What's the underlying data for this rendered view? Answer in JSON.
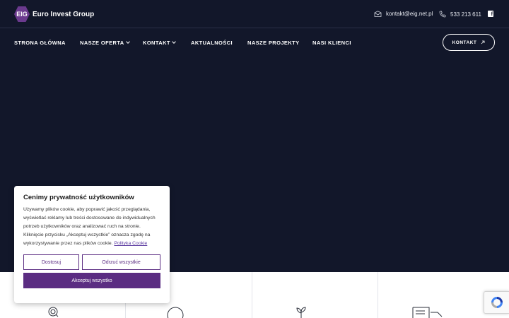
{
  "brand": {
    "badge": "EIG",
    "name": "Euro Invest Group"
  },
  "topbar": {
    "email": "kontakt@eig.net.pl",
    "phone": "533 213 611",
    "social_icon": "facebook-icon"
  },
  "nav": {
    "items": [
      {
        "label": "STRONA GŁÓWNA",
        "has_dropdown": false
      },
      {
        "label": "NASZE OFERTA",
        "has_dropdown": true
      },
      {
        "label": "KONTAKT",
        "has_dropdown": true
      },
      {
        "label": "AKTUALNOŚCI",
        "has_dropdown": false
      },
      {
        "label": "NASZE PROJEKTY",
        "has_dropdown": false
      },
      {
        "label": "NASI KLIENCI",
        "has_dropdown": false
      }
    ],
    "cta_label": "KONTAKT"
  },
  "cookie_banner": {
    "title": "Cenimy prywatność użytkowników",
    "text": "Używamy plików cookie, aby poprawić jakość przeglądania, wyświetlać reklamy lub treści dostosowane do indywidualnych potrzeb użytkowników oraz analizować ruch na stronie. Kliknięcie przycisku „Akceptuj wszystkie” oznacza zgodę na wykorzystywanie przez nas plików cookie.",
    "policy_link": "Polityka Cookie",
    "customize_label": "Dostosuj",
    "reject_label": "Odrzuć wszystkie",
    "accept_label": "Akceptuj wszystko"
  },
  "colors": {
    "background": "#12172a",
    "accent": "#5b2d82",
    "logo_badge": "#6b3a8e"
  },
  "icons": [
    "email-icon",
    "phone-icon",
    "facebook-icon",
    "arrow-up-right-icon",
    "coin-search-icon",
    "circle-icon",
    "leaf-icon",
    "document-icon",
    "recaptcha-icon"
  ]
}
